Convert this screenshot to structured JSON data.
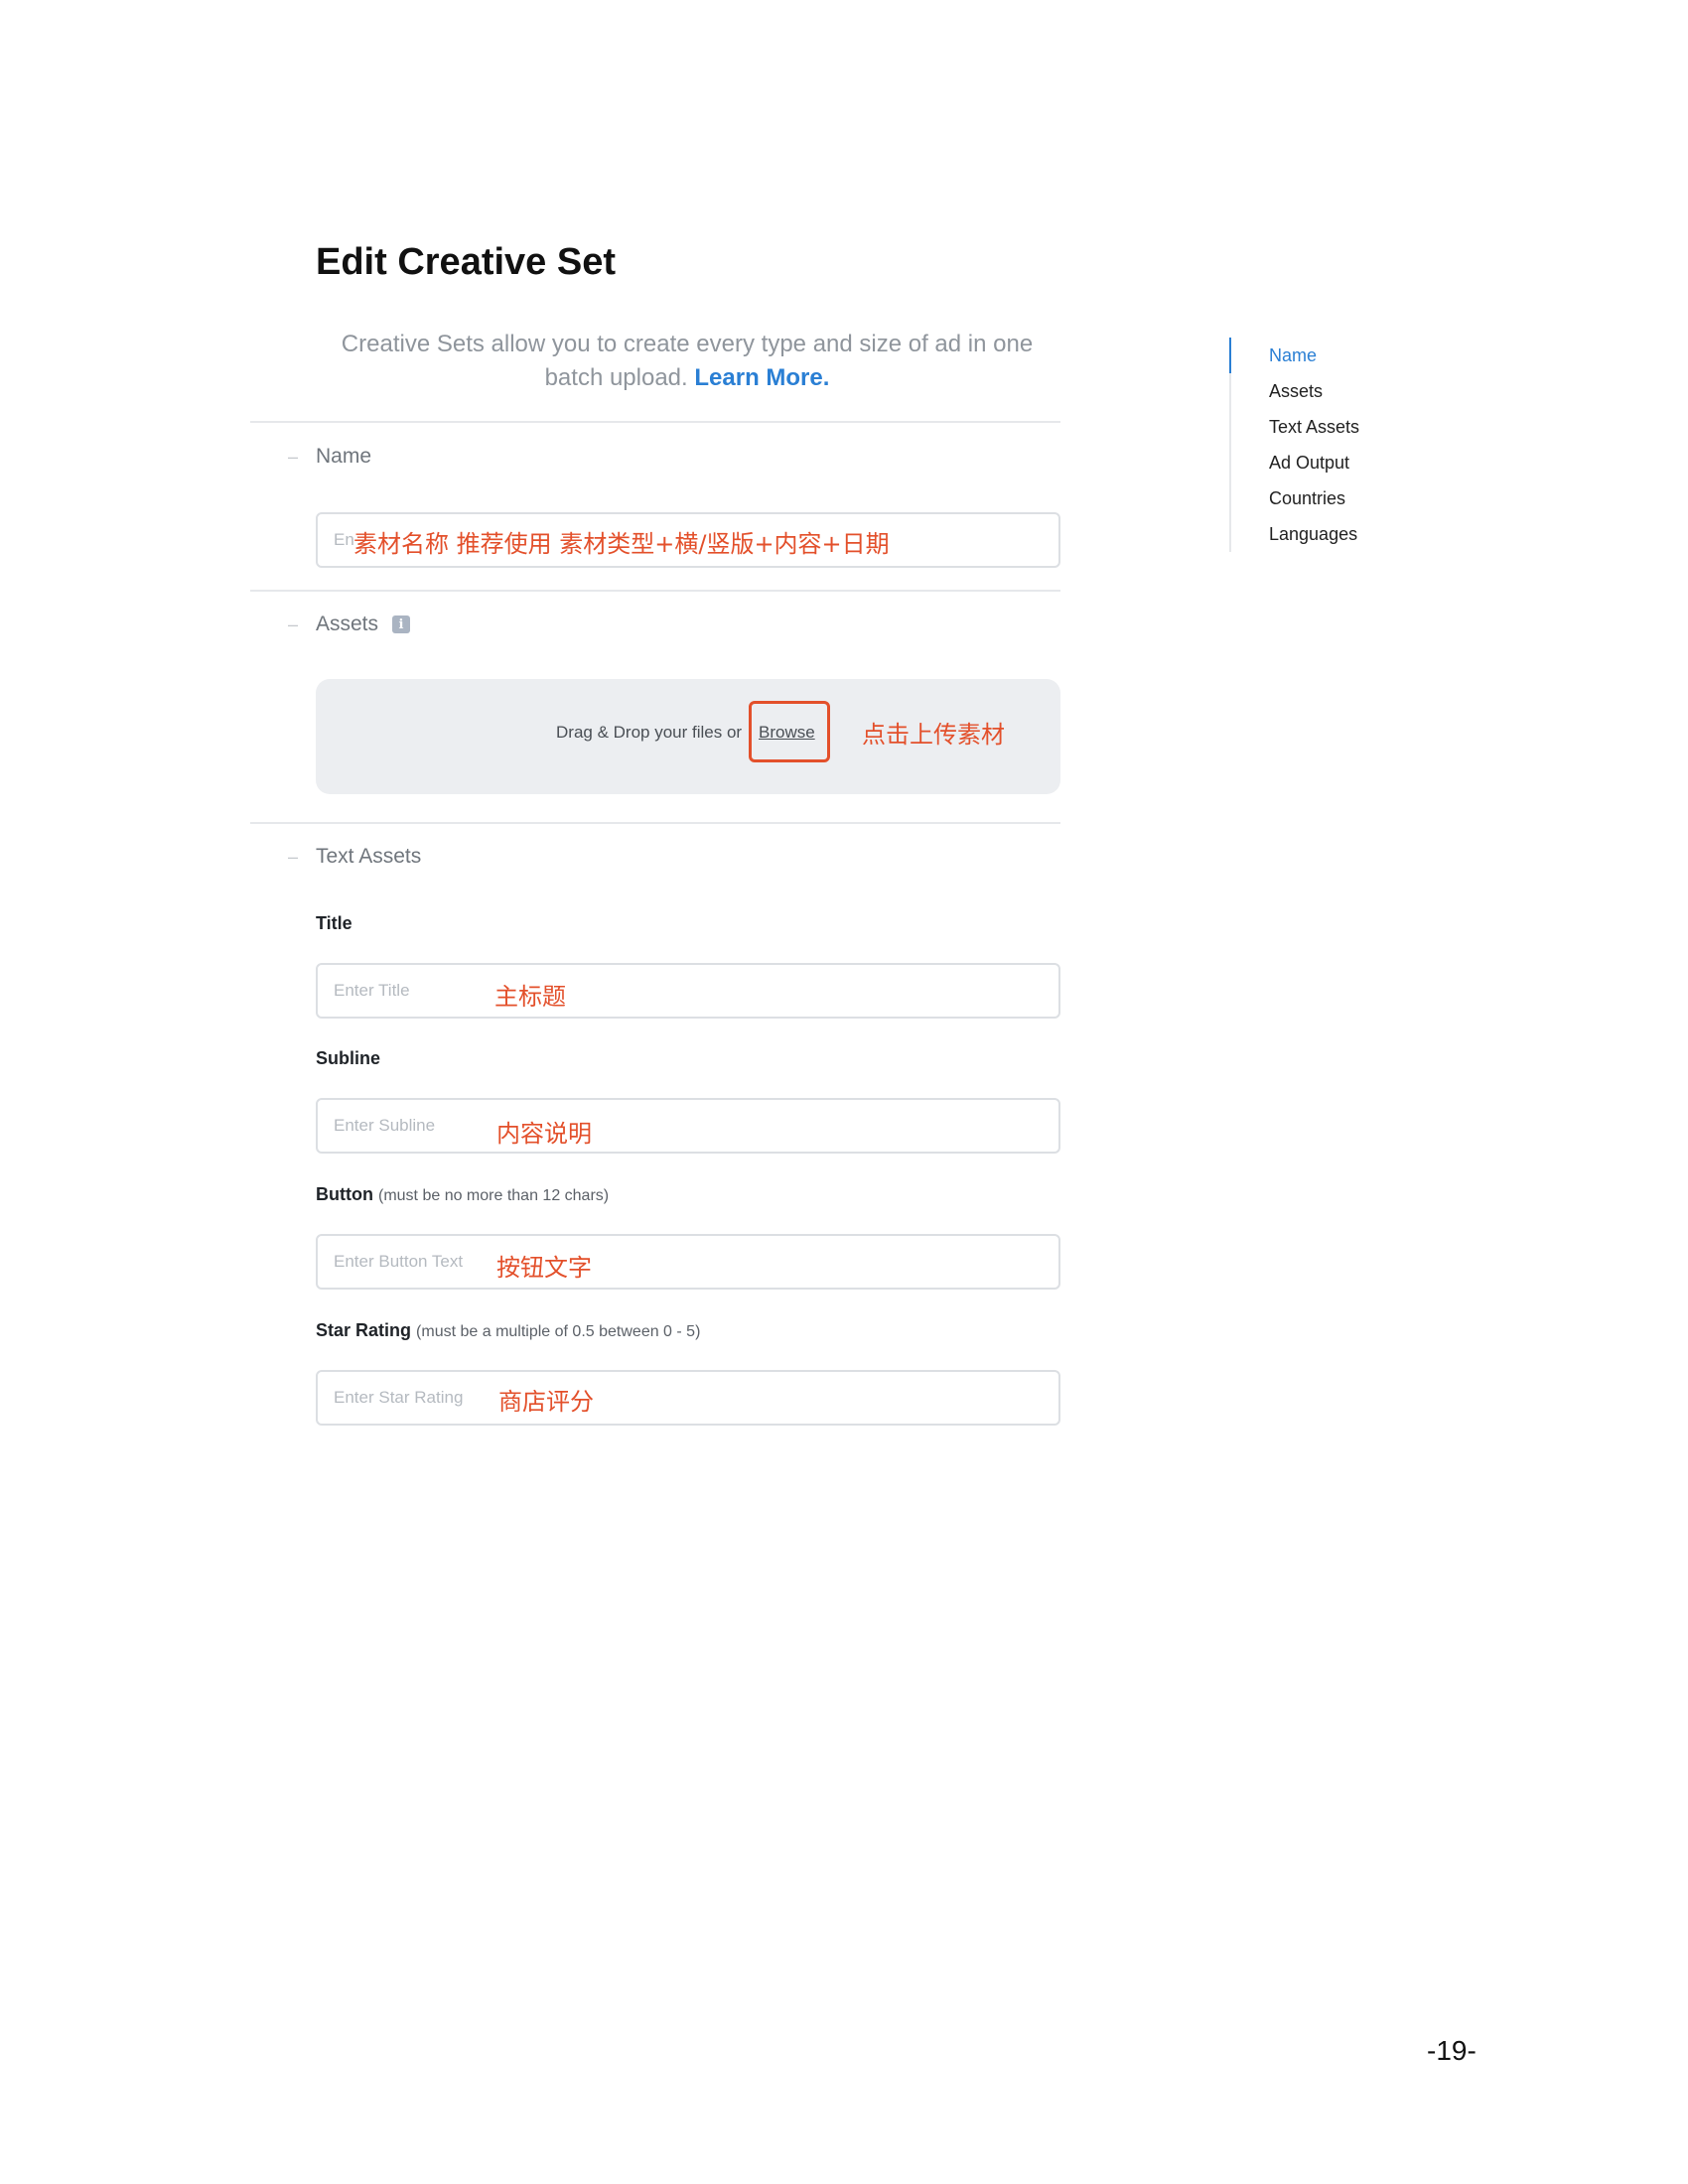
{
  "header": {
    "title": "Edit Creative Set",
    "intro_text": "Creative Sets allow you to create every type and size of ad in one batch upload.",
    "learn_more": "Learn More."
  },
  "sections": {
    "name": {
      "label": "Name",
      "placeholder": "Enter Creative Set Name",
      "annotation": "素材名称 推荐使用 素材类型+横/竖版+内容+日期"
    },
    "assets": {
      "label": "Assets",
      "info_glyph": "i",
      "drop_text": "Drag & Drop your files or",
      "browse_label": "Browse",
      "annotation": "点击上传素材"
    },
    "text_assets": {
      "label": "Text Assets",
      "title": {
        "label": "Title",
        "placeholder": "Enter Title",
        "annotation": "主标题"
      },
      "subline": {
        "label": "Subline",
        "placeholder": "Enter Subline",
        "annotation": "内容说明"
      },
      "button": {
        "label": "Button",
        "hint": "(must be no more than 12 chars)",
        "placeholder": "Enter Button Text",
        "annotation": "按钮文字"
      },
      "star_rating": {
        "label": "Star Rating",
        "hint": "(must be a multiple of 0.5 between 0 - 5)",
        "placeholder": "Enter Star Rating",
        "annotation": "商店评分"
      }
    }
  },
  "toc": {
    "items": [
      "Name",
      "Assets",
      "Text Assets",
      "Ad Output",
      "Countries",
      "Languages"
    ],
    "active": "Name"
  },
  "page_number": "-19-",
  "colors": {
    "accent": "#2a7fd4",
    "annotation": "#e3502b",
    "muted": "#8f959c"
  }
}
